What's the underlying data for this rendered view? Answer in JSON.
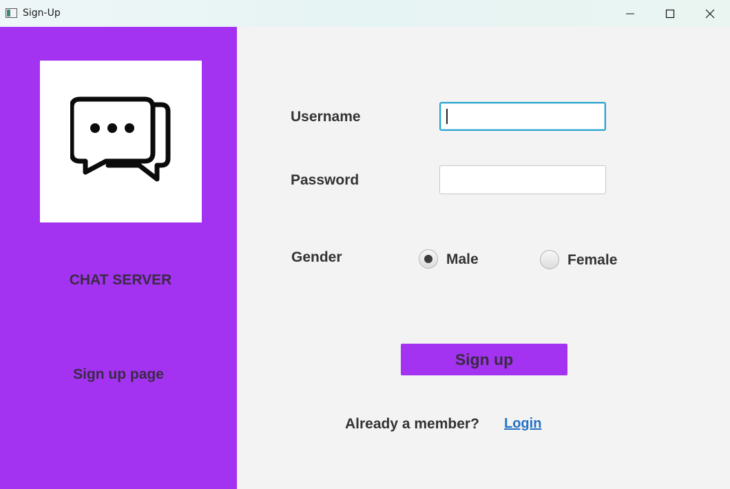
{
  "window": {
    "title": "Sign-Up",
    "controls": [
      "minimize",
      "maximize",
      "close"
    ]
  },
  "sidebar": {
    "background": "#a333f0",
    "logo_icon": "chat-bubbles-icon",
    "brand_title": "CHAT SERVER",
    "subtitle": "Sign up page"
  },
  "form": {
    "username_label": "Username",
    "username_value": "",
    "password_label": "Password",
    "password_value": "",
    "gender_label": "Gender",
    "gender_options": [
      "Male",
      "Female"
    ],
    "gender_selected": "Male",
    "signup_label": "Sign up",
    "member_prompt": "Already a member?",
    "login_link": "Login"
  },
  "colors": {
    "accent": "#a333f0",
    "focus_border": "#2aa4cf",
    "link": "#2372c4"
  }
}
